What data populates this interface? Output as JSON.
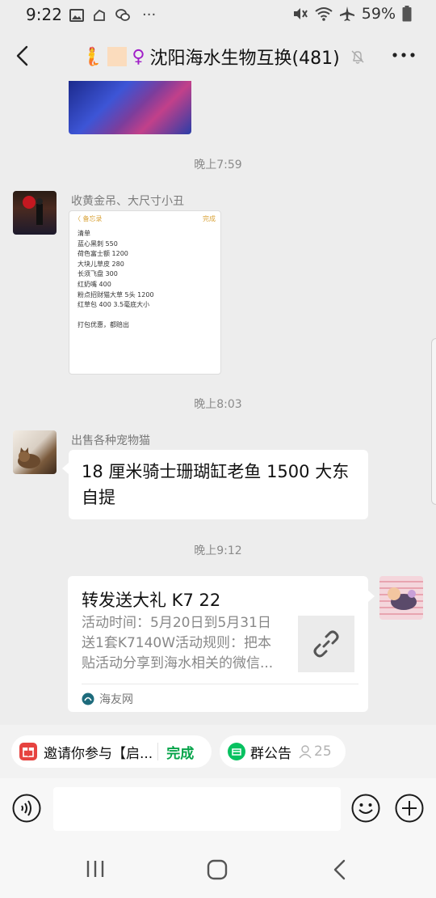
{
  "status_bar": {
    "time": "9:22",
    "dots": "···",
    "battery": "59%"
  },
  "header": {
    "emoji_prefix": "🧜",
    "symbol": "♀",
    "group_name": "沈阳海水生物互换(481)"
  },
  "messages": {
    "time_1": "晚上7:59",
    "sender_1": "收黄金吊、大尺寸小丑",
    "note_header_left": "〈 备忘录",
    "note_header_right": "完成",
    "note_lines": "清单\n蓝心黑刺 550\n荷色富士额 1200\n大块儿草皮 280\n长须飞盘 300\n红奶嘴 400\n粉点招财猫大草 5头 1200\n红草包 400 3.5毫底大小\n\n打包优惠，都赔出",
    "time_2": "晚上8:03",
    "sender_2": "出售各种宠物猫",
    "text_2": "18 厘米骑士珊瑚缸老鱼  1500 大东自提",
    "time_3": "晚上9:12",
    "link_title": "转发送大礼 K7 22",
    "link_desc": "活动时间：5月20日到5月31日送1套K7140W活动规则：把本贴活动分享到海水相关的微信...",
    "link_source": "海友网"
  },
  "pinned": {
    "invite_text": "邀请你参与【启...",
    "invite_action": "完成",
    "notice_label": "群公告",
    "notice_count": "25"
  },
  "input": {
    "placeholder": ""
  },
  "colors": {
    "background": "#ededed",
    "bubble": "#ffffff",
    "accent_green": "#07a44a"
  }
}
